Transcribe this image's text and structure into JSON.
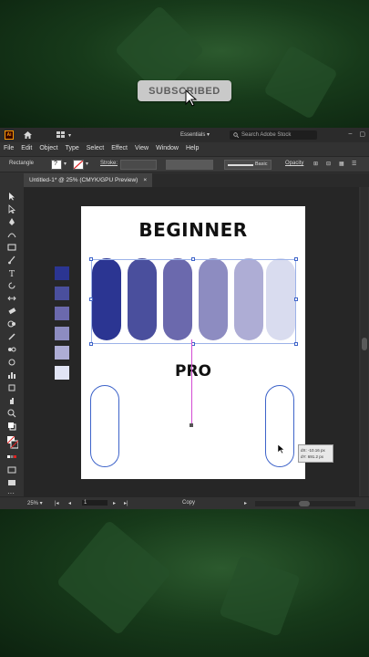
{
  "overlay": {
    "subscribe_label": "SUBSCRIBED"
  },
  "app": {
    "logo_text": "Ai",
    "workspace": "Essentials",
    "stock_search_placeholder": "Search Adobe Stock",
    "menu": [
      "File",
      "Edit",
      "Object",
      "Type",
      "Select",
      "Effect",
      "View",
      "Window",
      "Help"
    ],
    "control_bar": {
      "tool_name": "Rectangle",
      "stroke_label": "Stroke:",
      "brush_label": "Basic",
      "opacity_label": "Opacity"
    },
    "document_tab": {
      "title": "Untitled-1* @ 25% (CMYK/GPU Preview)",
      "close_glyph": "×"
    },
    "status": {
      "zoom": "25%",
      "artboard_number": "1",
      "mode": "Copy"
    }
  },
  "artboard": {
    "heading_top": "BEGINNER",
    "heading_bottom": "PRO",
    "pill_colors": [
      "#2b3592",
      "#4a4f9d",
      "#6b69ad",
      "#8d8cc1",
      "#aeadd5",
      "#d9dcef"
    ],
    "swatch_colors": [
      "#2b3592",
      "#4a4f9d",
      "#6b69ad",
      "#8d8cc1",
      "#aeadd5",
      "#e1e4f4"
    ]
  },
  "measure_tooltip": {
    "dx": "dX: -10.16 px",
    "dy": "dY: 691.2 px"
  },
  "colors": {
    "selection_accent": "#3d63c9",
    "smart_guide": "#d34bd3",
    "app_bg": "#323232"
  }
}
